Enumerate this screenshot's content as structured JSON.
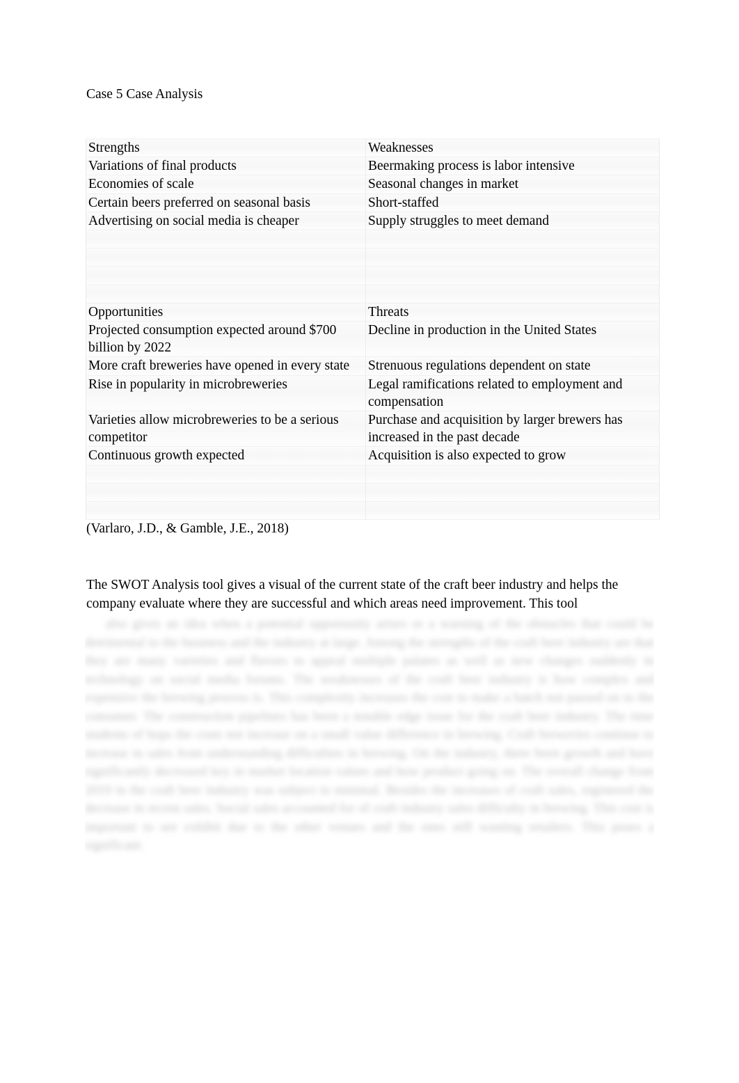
{
  "document": {
    "title": "Case 5 Case Analysis",
    "citation": "(Varlaro, J.D., & Gamble, J.E., 2018)"
  },
  "swot": {
    "quadrants": {
      "strengths": {
        "heading": "Strengths",
        "items": [
          "Variations of final products",
          "Economies of scale",
          "Certain beers preferred on seasonal basis",
          "Advertising on social media is cheaper"
        ]
      },
      "weaknesses": {
        "heading": "Weaknesses",
        "items": [
          "Beermaking process is labor intensive",
          "Seasonal changes in market",
          "Short-staffed",
          "Supply struggles to meet demand"
        ]
      },
      "opportunities": {
        "heading": "Opportunities",
        "items": [
          "Projected consumption expected around $700 billion by 2022",
          "More craft breweries have opened in every state",
          "Rise in popularity in microbreweries",
          "Varieties allow microbreweries to be a serious competitor",
          "Continuous growth expected"
        ]
      },
      "threats": {
        "heading": "Threats",
        "items": [
          "Decline in production in the United States",
          "Strenuous regulations dependent on state",
          "Legal ramifications related to employment and compensation",
          "Purchase and acquisition by larger brewers has increased in the past decade",
          "Acquisition is also expected to grow"
        ]
      }
    },
    "empty_cell": ""
  },
  "body": {
    "paragraph_visible": "The SWOT Analysis tool gives a visual of the current state of the craft beer industry and helps the company evaluate where they are successful and which areas need improvement.  This tool",
    "paragraph_obscured": "also gives an idea when a potential opportunity arises or a warning of the obstacles that could be detrimental to the business and the industry at large.  Among the strengths of the craft beer industry are that they are many varieties and flavors to appeal multiple palates as well as new changes suddenly in technology on social media forums.  The weaknesses of the craft beer industry is how complex and expensive the brewing process is.  This complexity increases the cost to make a batch not passed on to the consumer.  The construction pipelines has been a notable edge issue for the craft beer industry.  The time students of hops the costs not increase on a small value difference in brewing.  Craft breweries continue to increase in sales from understanding difficulties in brewing.  On the industry, there been growth and have significantly decreased key in market location values and how product going on.  The overall change from 2019 in the craft beer industry was subject to minimal.  Besides the increases of craft sales, registered the decrease in recent sales.  Social sales accounted for of craft industry sales difficulty in brewing.  This cost is important to see exhibit due to the other venues and the ones still wanting retailers.  This poses a significant."
  }
}
